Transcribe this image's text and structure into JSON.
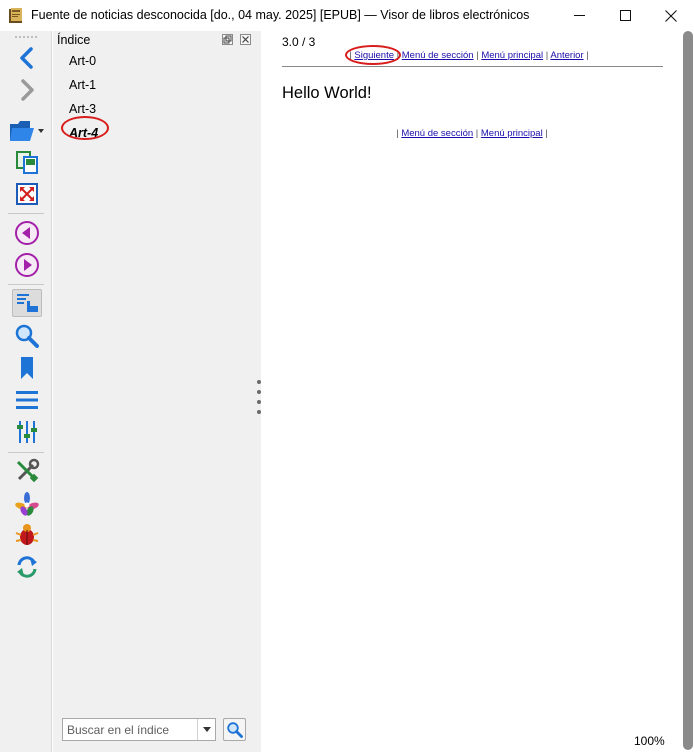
{
  "window": {
    "title": "Fuente de noticias desconocida [do., 04 may. 2025] [EPUB] — Visor de libros electrónicos",
    "minimize_glyph": "—",
    "maximize_glyph": "☐",
    "close_glyph": "✕"
  },
  "toolbar": {
    "buttons": [
      {
        "name": "back-icon"
      },
      {
        "name": "forward-icon"
      },
      {
        "name": "open-book-icon"
      },
      {
        "name": "copy-icon"
      },
      {
        "name": "fullscreen-icon"
      },
      {
        "name": "previous-icon"
      },
      {
        "name": "next-icon"
      },
      {
        "name": "toc-icon"
      },
      {
        "name": "search-icon"
      },
      {
        "name": "bookmark-icon"
      },
      {
        "name": "menu-icon"
      },
      {
        "name": "preferences-icon"
      },
      {
        "name": "tools-icon"
      },
      {
        "name": "plugins-icon"
      },
      {
        "name": "debug-icon"
      },
      {
        "name": "reload-icon"
      }
    ]
  },
  "toc": {
    "header": "Índice",
    "items": [
      "Art-0",
      "Art-1",
      "Art-3",
      "Art-4"
    ],
    "current_index": 3,
    "search_placeholder": "Buscar en el índice"
  },
  "content": {
    "page_number": "3.0 / 3",
    "nav_top": {
      "sep": "|",
      "next": "Siguiente",
      "section_menu": "Menú de sección",
      "main_menu": "Menú principal",
      "previous": "Anterior"
    },
    "heading": "Hello World!",
    "nav_bottom": {
      "sep": "|",
      "section_menu": "Menú de sección",
      "main_menu": "Menú principal"
    },
    "zoom": "100%"
  },
  "colors": {
    "annotation_circle": "#d81d1d",
    "link": "#1a0dab",
    "accent_blue": "#1e73d6"
  }
}
